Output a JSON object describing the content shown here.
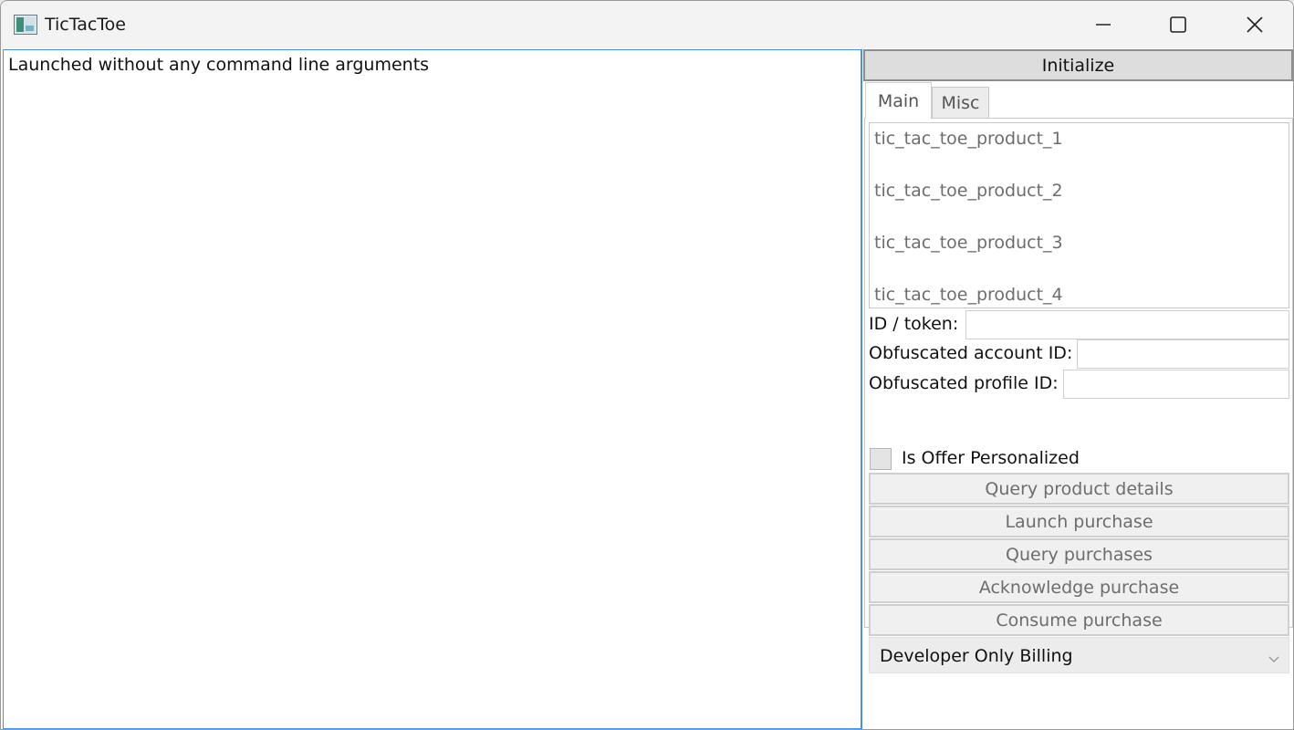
{
  "window": {
    "title": "TicTacToe",
    "icon": "app-window-icon",
    "controls": {
      "minimize": "minimize-icon",
      "maximize": "maximize-icon",
      "close": "close-icon"
    }
  },
  "log": {
    "text": "Launched without any command line arguments"
  },
  "panel": {
    "initialize_label": "Initialize",
    "tabs": [
      {
        "label": "Main",
        "selected": true
      },
      {
        "label": "Misc",
        "selected": false
      }
    ],
    "products": [
      "tic_tac_toe_product_1",
      "tic_tac_toe_product_2",
      "tic_tac_toe_product_3",
      "tic_tac_toe_product_4"
    ],
    "fields": {
      "id_token": {
        "label": "ID / token:",
        "value": ""
      },
      "account_id": {
        "label": "Obfuscated account ID:",
        "value": ""
      },
      "profile_id": {
        "label": "Obfuscated profile ID:",
        "value": ""
      }
    },
    "offer_personalized": {
      "label": "Is Offer Personalized",
      "checked": false
    },
    "buttons": {
      "query_details": "Query product details",
      "launch_purchase": "Launch purchase",
      "query_purchases": "Query purchases",
      "acknowledge": "Acknowledge purchase",
      "consume": "Consume purchase"
    },
    "billing_select": {
      "selected": "Developer Only Billing"
    }
  },
  "colors": {
    "focus_border": "#4a90e2",
    "disabled_text": "#6d6d6d",
    "button_bg": "#f0f0f0"
  }
}
